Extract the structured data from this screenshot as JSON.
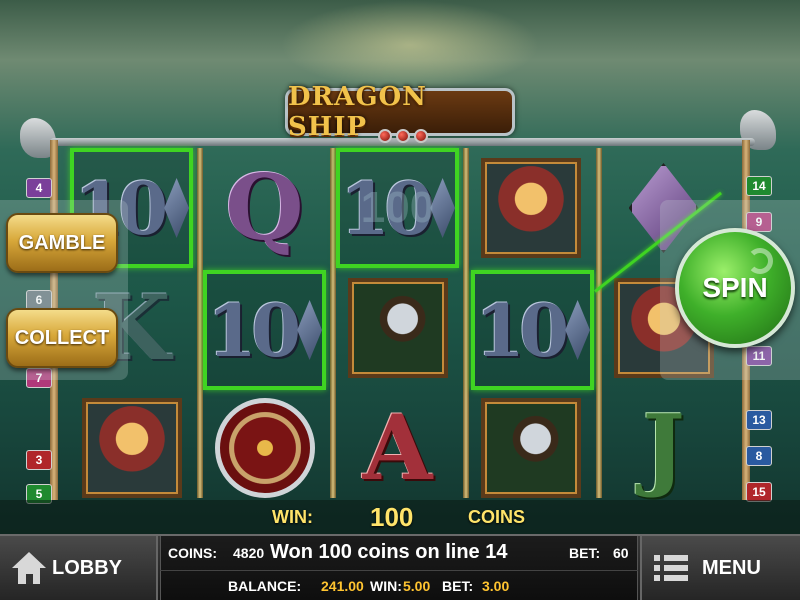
{
  "game": {
    "title": "DRAGON SHIP"
  },
  "reels": {
    "col1": [
      "10",
      "K",
      "viking"
    ],
    "col2": [
      "Q",
      "10",
      "shield"
    ],
    "col3": [
      "10",
      "axe",
      "A"
    ],
    "col4": [
      "viking",
      "10",
      "axe"
    ],
    "col5": [
      "purple-diamond",
      "viking",
      "J"
    ],
    "ghost_text": "100"
  },
  "paylines": {
    "left": [
      "4",
      "6",
      "7",
      "3",
      "5"
    ],
    "right": [
      "14",
      "9",
      "11",
      "13",
      "8",
      "15"
    ]
  },
  "buttons": {
    "gamble": "GAMBLE",
    "collect": "COLLECT",
    "spin": "SPIN",
    "lobby": "LOBBY",
    "menu": "MENU"
  },
  "win_strip": {
    "win_label": "WIN:",
    "win_amount": "100",
    "coins_label": "COINS"
  },
  "info": {
    "coins_label": "COINS:",
    "coins_value": "4820",
    "message": "Won 100 coins on line 14",
    "bet_label": "BET:",
    "bet_value": "60",
    "balance_label": "BALANCE:",
    "balance_value": "241.00",
    "win_label": "WIN:",
    "win_value": "5.00",
    "bet2_label": "BET:",
    "bet2_value": "3.00"
  },
  "colors": {
    "win_highlight": "#3fd422",
    "gold_text": "#ffc430",
    "spin_green": "#3fb02a"
  }
}
